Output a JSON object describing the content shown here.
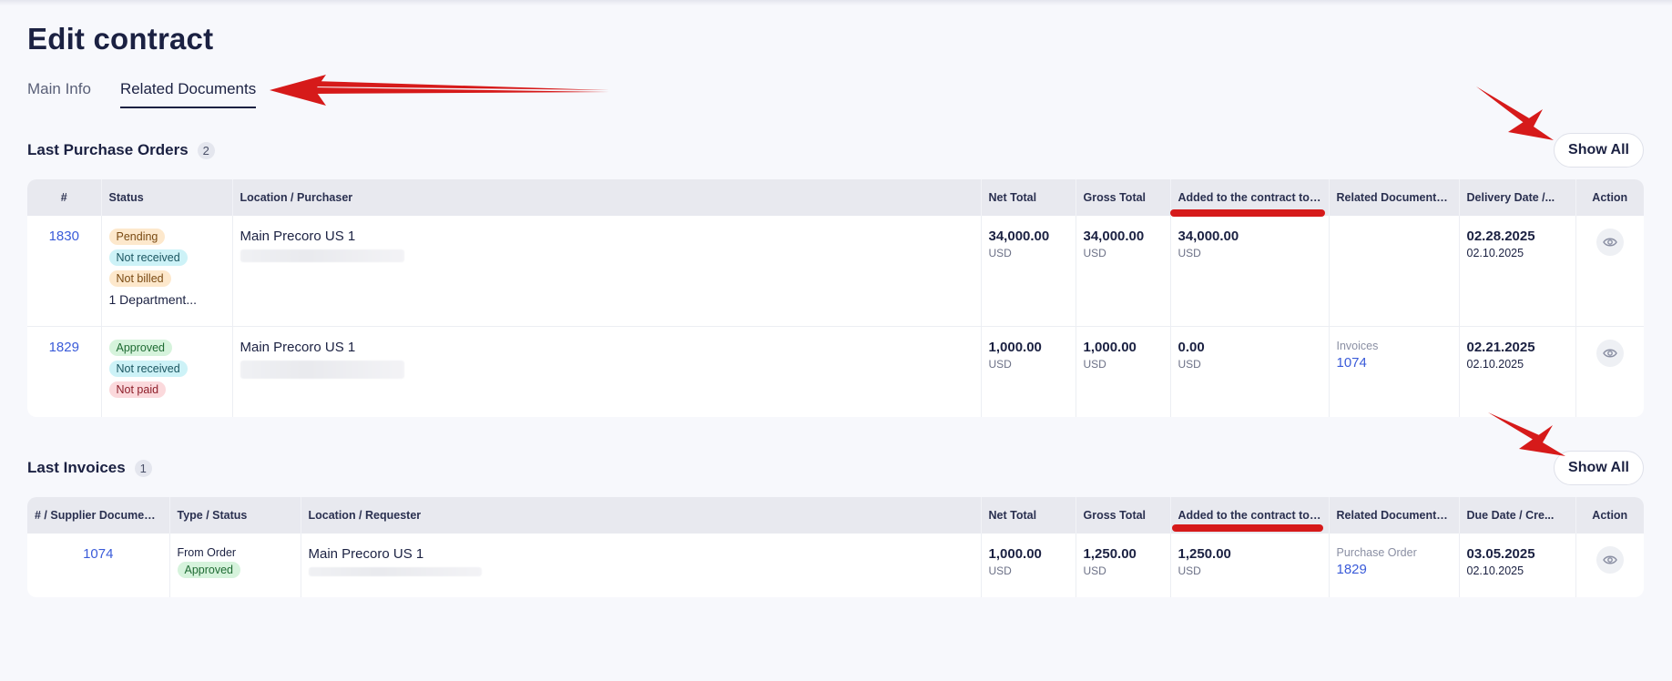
{
  "page": {
    "title": "Edit contract",
    "tabs": [
      {
        "label": "Main Info",
        "active": false
      },
      {
        "label": "Related Documents",
        "active": true
      }
    ]
  },
  "purchase_orders": {
    "title": "Last Purchase Orders",
    "count": "2",
    "show_all_label": "Show All",
    "columns": [
      "#",
      "Status",
      "Location / Purchaser",
      "Net Total",
      "Gross Total",
      "Added to the contract total",
      "Related Documents, #",
      "Delivery Date /...",
      "Action"
    ],
    "rows": [
      {
        "number": "1830",
        "statuses": [
          {
            "label": "Pending",
            "color": "orange"
          },
          {
            "label": "Not received",
            "color": "cyan"
          },
          {
            "label": "Not billed",
            "color": "orange"
          }
        ],
        "department": "1 Department...",
        "location": "Main Precoro US 1",
        "net_total": "34,000.00",
        "net_currency": "USD",
        "gross_total": "34,000.00",
        "gross_currency": "USD",
        "added_total": "34,000.00",
        "added_currency": "USD",
        "related_label": "",
        "related_number": "",
        "date_main": "02.28.2025",
        "date_sub": "02.10.2025"
      },
      {
        "number": "1829",
        "statuses": [
          {
            "label": "Approved",
            "color": "green"
          },
          {
            "label": "Not received",
            "color": "cyan"
          },
          {
            "label": "Not paid",
            "color": "red"
          }
        ],
        "department": "",
        "location": "Main Precoro US 1",
        "net_total": "1,000.00",
        "net_currency": "USD",
        "gross_total": "1,000.00",
        "gross_currency": "USD",
        "added_total": "0.00",
        "added_currency": "USD",
        "related_label": "Invoices",
        "related_number": "1074",
        "date_main": "02.21.2025",
        "date_sub": "02.10.2025"
      }
    ]
  },
  "invoices": {
    "title": "Last Invoices",
    "count": "1",
    "show_all_label": "Show All",
    "columns": [
      "# / Supplier Document #",
      "Type / Status",
      "Location / Requester",
      "Net Total",
      "Gross Total",
      "Added to the contract total",
      "Related Documents, #",
      "Due Date / Cre...",
      "Action"
    ],
    "rows": [
      {
        "number": "1074",
        "type": "From Order",
        "status": "Approved",
        "location": "Main Precoro US 1",
        "net_total": "1,000.00",
        "net_currency": "USD",
        "gross_total": "1,250.00",
        "gross_currency": "USD",
        "added_total": "1,250.00",
        "added_currency": "USD",
        "related_label": "Purchase Order",
        "related_number": "1829",
        "date_main": "03.05.2025",
        "date_sub": "02.10.2025"
      }
    ]
  },
  "colors": {
    "accent_link": "#3a5bd9",
    "annotation_red": "#d61a1a",
    "badge_pending": "#fde8cc",
    "badge_received": "#cdf2f7",
    "badge_approved": "#d6f3dc",
    "badge_not_paid": "#fbd9dc"
  },
  "icons": {
    "action": "eye-icon",
    "annotation": "red-arrow"
  }
}
